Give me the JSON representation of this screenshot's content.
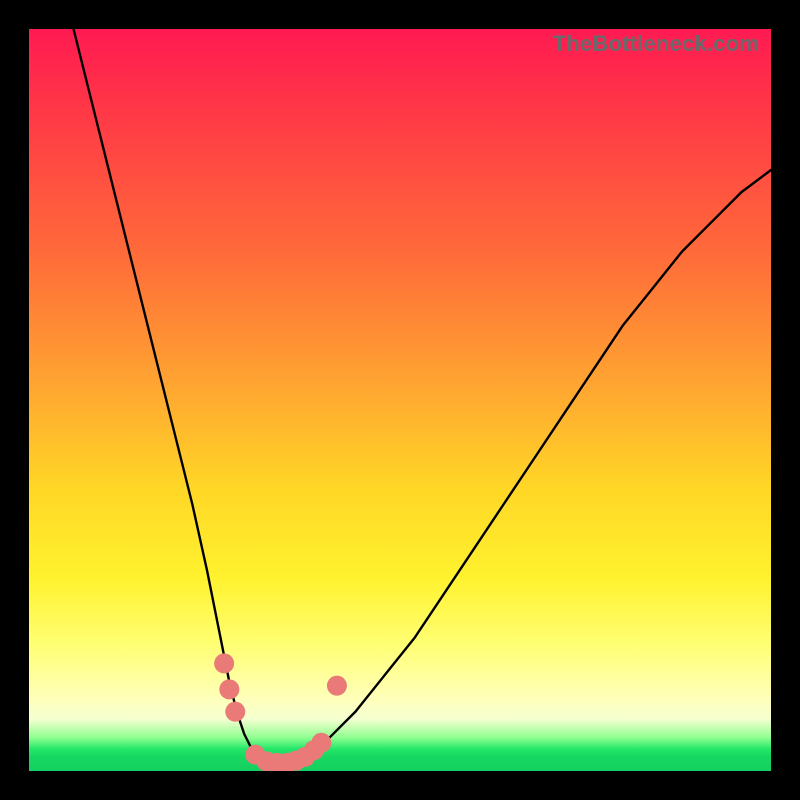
{
  "watermark": {
    "text": "TheBottleneck.com"
  },
  "chart_data": {
    "type": "line",
    "title": "",
    "xlabel": "",
    "ylabel": "",
    "xlim": [
      0,
      100
    ],
    "ylim": [
      0,
      100
    ],
    "grid": false,
    "series": [
      {
        "name": "curve",
        "x": [
          6,
          8,
          10,
          12,
          14,
          16,
          18,
          20,
          22,
          24,
          25,
          26,
          27,
          28,
          29,
          30,
          31,
          32,
          33,
          34,
          35,
          36,
          38,
          40,
          44,
          48,
          52,
          56,
          60,
          64,
          68,
          72,
          76,
          80,
          84,
          88,
          92,
          96,
          100
        ],
        "y": [
          100,
          92,
          84,
          76,
          68,
          60,
          52,
          44,
          36,
          27,
          22,
          17,
          12,
          8,
          5,
          3,
          2,
          1.3,
          1,
          1,
          1.2,
          1.5,
          2.5,
          4,
          8,
          13,
          18,
          24,
          30,
          36,
          42,
          48,
          54,
          60,
          65,
          70,
          74,
          78,
          81
        ]
      }
    ],
    "markers": [
      {
        "x": 26.3,
        "y": 14.5
      },
      {
        "x": 27.0,
        "y": 11.0
      },
      {
        "x": 27.8,
        "y": 8.0
      },
      {
        "x": 30.5,
        "y": 2.2
      },
      {
        "x": 32.0,
        "y": 1.3
      },
      {
        "x": 33.4,
        "y": 1.1
      },
      {
        "x": 34.8,
        "y": 1.1
      },
      {
        "x": 36.0,
        "y": 1.4
      },
      {
        "x": 37.2,
        "y": 1.9
      },
      {
        "x": 38.4,
        "y": 2.8
      },
      {
        "x": 39.4,
        "y": 3.8
      },
      {
        "x": 41.5,
        "y": 11.5
      }
    ],
    "marker_color": "#e97a78",
    "line_color": "#000000"
  }
}
